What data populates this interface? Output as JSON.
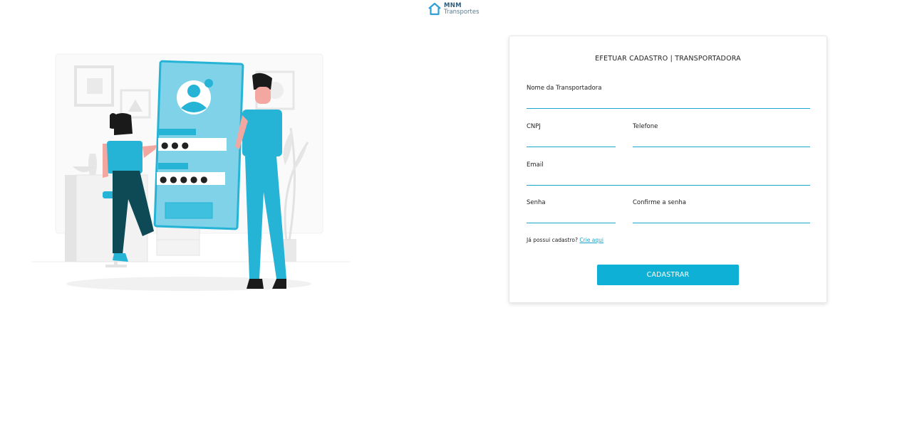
{
  "brand": {
    "line1": "MNM",
    "line2": "Transportes",
    "icon": "house-icon",
    "color": "#2f9fd6"
  },
  "illustration": {
    "icon": "signup-illustration",
    "password_mask_1": "● ● ●",
    "password_mask_2": "● ● ● ● ●"
  },
  "form": {
    "title": "EFETUAR CADASTRO | TRANSPORTADORA",
    "fields": {
      "nome": {
        "label": "Nome da Transportadora",
        "value": ""
      },
      "cnpj": {
        "label": "CNPJ",
        "value": ""
      },
      "telefone": {
        "label": "Telefone",
        "value": ""
      },
      "email": {
        "label": "Email",
        "value": ""
      },
      "senha": {
        "label": "Senha",
        "value": ""
      },
      "confirma": {
        "label": "Confirme a senha",
        "value": ""
      }
    },
    "login_prompt": "Já possui cadastro?",
    "login_link": "Crie aqui",
    "submit_label": "CADASTRAR"
  },
  "colors": {
    "accent": "#0fb0d6",
    "underline": "#1aa6cc",
    "illustration_primary": "#26b4d6",
    "illustration_dark": "#0d4a55"
  }
}
